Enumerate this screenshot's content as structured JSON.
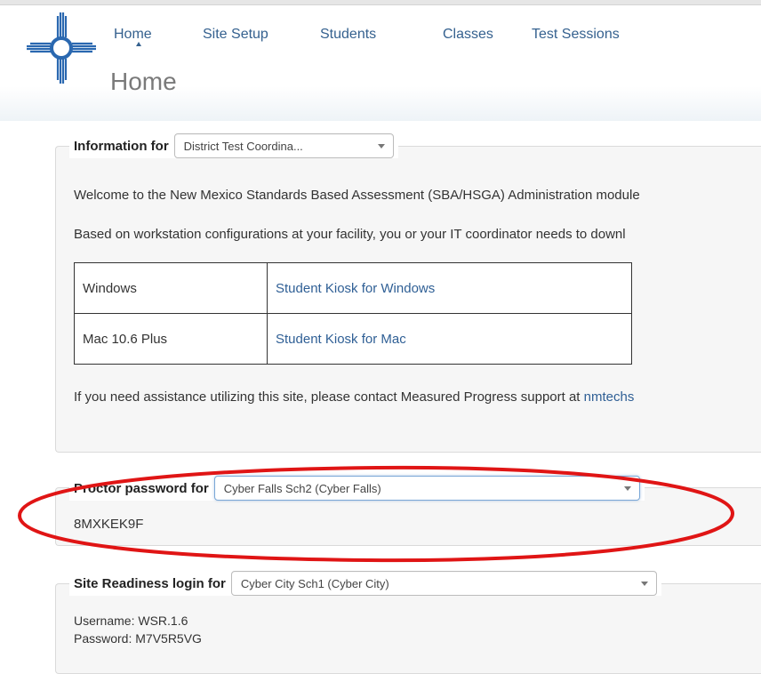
{
  "nav": {
    "items": [
      "Home",
      "Site Setup",
      "Students",
      "Classes",
      "Test Sessions"
    ],
    "active": "Home"
  },
  "page": {
    "title": "Home"
  },
  "info_panel": {
    "legend_label": "Information for",
    "role_select": "District Test Coordina...",
    "welcome_text": "Welcome to the New Mexico Standards Based Assessment (SBA/HSGA) Administration module",
    "config_text": "Based on workstation configurations at your facility, you or your IT coordinator needs to downl",
    "kiosk_table": {
      "rows": [
        {
          "platform": "Windows",
          "download": "Student Kiosk for Windows"
        },
        {
          "platform": "Mac 10.6 Plus",
          "download": "Student Kiosk for Mac"
        }
      ]
    },
    "assistance_text": "If you need assistance utilizing this site, please contact Measured Progress support at ",
    "support_link": "nmtechs"
  },
  "proctor_panel": {
    "legend_label": "Proctor password for",
    "school_select": "Cyber Falls Sch2 (Cyber Falls)",
    "password": "8MXKEK9F"
  },
  "readiness_panel": {
    "legend_label": "Site Readiness login for",
    "school_select": "Cyber City Sch1 (Cyber City)",
    "username_line": "Username: WSR.1.6",
    "password_line": "Password: M7V5R5VG"
  },
  "colors": {
    "nav_link": "#35618f",
    "link": "#2f5f95",
    "highlight_ellipse": "#e01515",
    "logo": "#2a68b0"
  },
  "icons": {
    "logo": "zia-sun-logo-icon"
  }
}
